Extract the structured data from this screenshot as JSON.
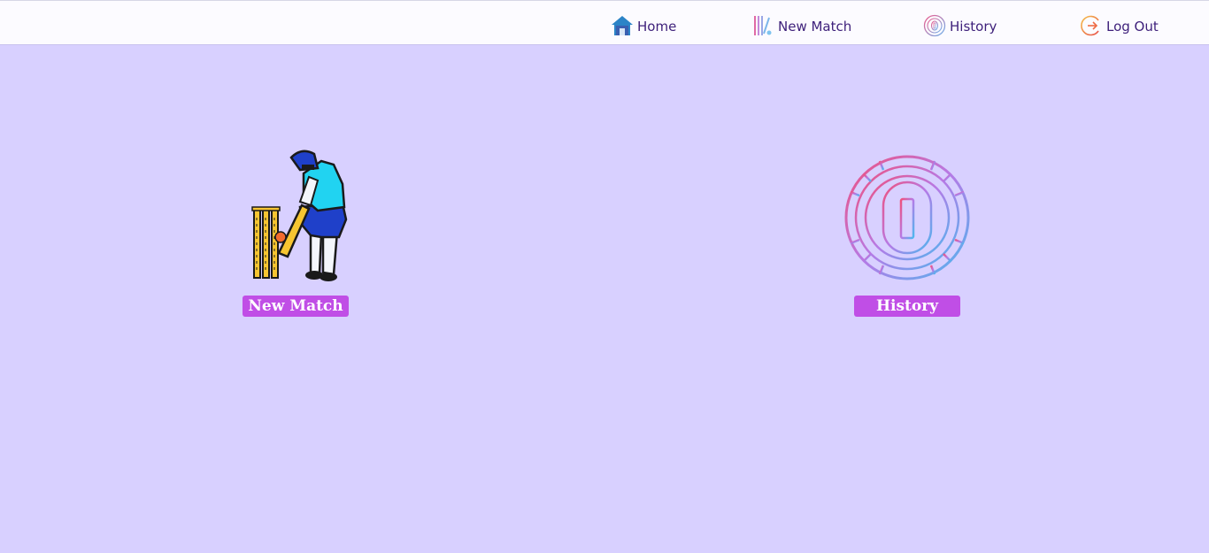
{
  "nav": {
    "home_label": "Home",
    "new_match_label": "New Match",
    "history_label": "History",
    "logout_label": "Log Out"
  },
  "cards": {
    "new_match": {
      "button_label": "New Match",
      "icon": "cricket-batsman-icon"
    },
    "history": {
      "button_label": "History",
      "icon": "coin-toss-icon"
    }
  },
  "colors": {
    "background": "#d8d0ff",
    "navbar": "#fcfbff",
    "nav_text": "#3d1f7a",
    "button": "#c04ee6",
    "button_text": "#ffffff"
  }
}
